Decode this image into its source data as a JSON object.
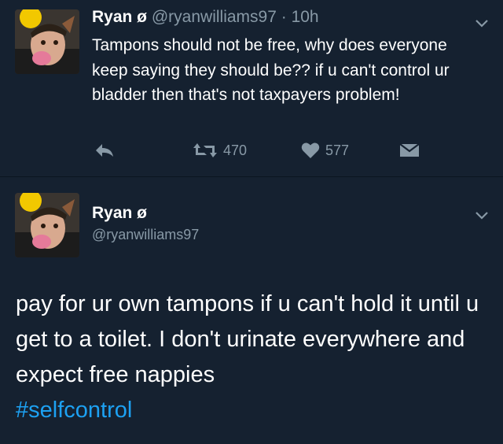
{
  "tweet1": {
    "display_name": "Ryan ø",
    "handle": "@ryanwilliams97",
    "separator": " · ",
    "time": "10h",
    "text": "Tampons should not be free, why does everyone keep saying they should be?? if u can't control ur bladder then that's not taxpayers problem!",
    "retweet_count": "470",
    "like_count": "577"
  },
  "tweet2": {
    "display_name": "Ryan ø",
    "handle": "@ryanwilliams97",
    "text": "pay for ur own tampons if u can't hold it until u get to a toilet. I don't urinate everywhere and expect free nappies",
    "hashtag": "#selfcontrol"
  },
  "icons": {
    "reply": "reply-icon",
    "retweet": "retweet-icon",
    "like": "heart-icon",
    "dm": "envelope-icon",
    "more": "chevron-down-icon"
  },
  "colors": {
    "background": "#152130",
    "secondary_text": "#8899a6",
    "hashtag": "#1da1f2"
  }
}
